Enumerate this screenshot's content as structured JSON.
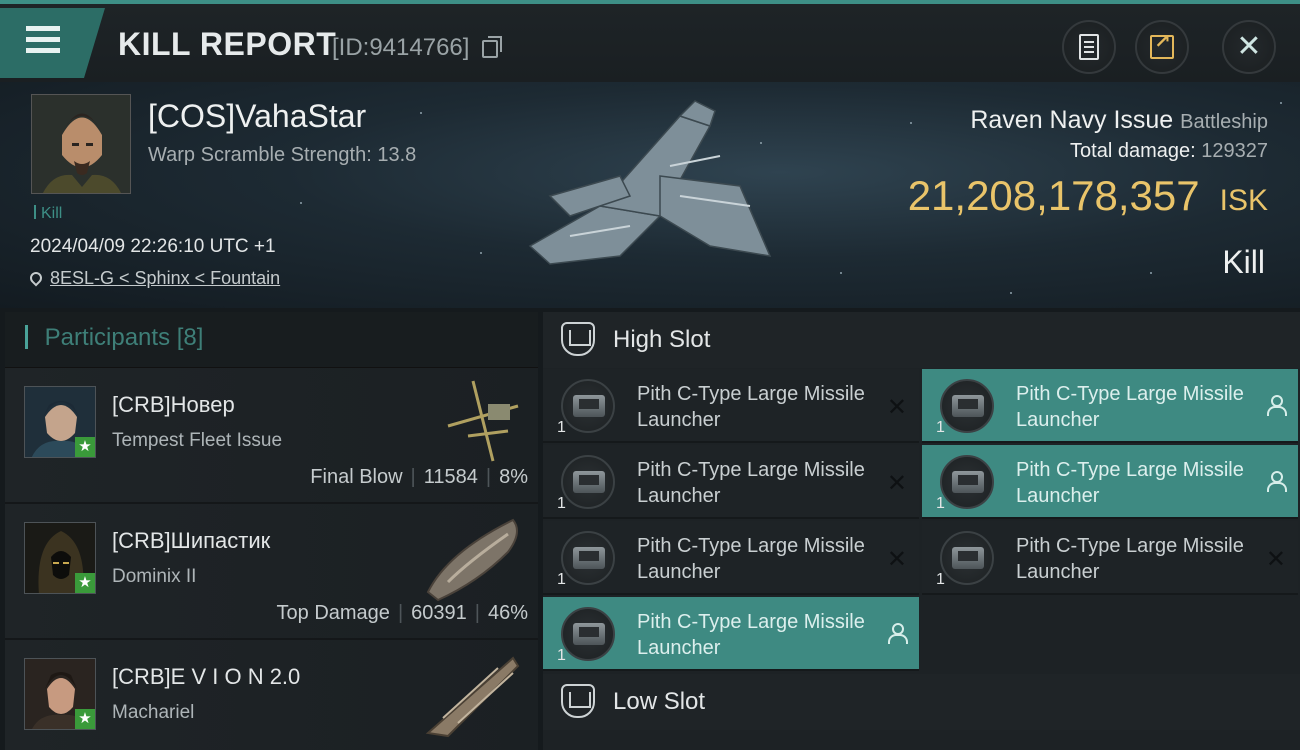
{
  "header": {
    "title": "KILL REPORT",
    "kill_id": "[ID:9414766]"
  },
  "victim": {
    "pilot": "[COS]VahaStar",
    "warp_scramble": "Warp Scramble Strength: 13.8",
    "tag": "Kill",
    "datetime": "2024/04/09 22:26:10 UTC +1",
    "location": "8ESL-G < Sphinx < Fountain",
    "ship": "Raven Navy Issue",
    "ship_class": "Battleship",
    "total_damage_label": "Total damage:",
    "total_damage": "129327",
    "isk_value": "21,208,178,357",
    "isk_unit": "ISK",
    "result": "Kill"
  },
  "participants": {
    "label": "Participants",
    "count": "[8]",
    "rows": [
      {
        "name": "[CRB]Новер",
        "ship": "Tempest Fleet Issue",
        "role": "Final Blow",
        "damage": "11584",
        "percent": "8%"
      },
      {
        "name": "[CRB]Шипастик",
        "ship": "Dominix II",
        "role": "Top Damage",
        "damage": "60391",
        "percent": "46%"
      },
      {
        "name": "[CRB]E V I O N 2.0",
        "ship": "Machariel",
        "role": "",
        "damage": "",
        "percent": ""
      }
    ]
  },
  "fitting": {
    "high_slot_label": "High Slot",
    "low_slot_label": "Low Slot",
    "high_slot_modules": [
      {
        "name": "Pith C-Type Large Missile Launcher",
        "qty": "1",
        "status": "destroyed"
      },
      {
        "name": "Pith C-Type Large Missile Launcher",
        "qty": "1",
        "status": "dropped"
      },
      {
        "name": "Pith C-Type Large Missile Launcher",
        "qty": "1",
        "status": "destroyed"
      },
      {
        "name": "Pith C-Type Large Missile Launcher",
        "qty": "1",
        "status": "dropped"
      },
      {
        "name": "Pith C-Type Large Missile Launcher",
        "qty": "1",
        "status": "destroyed"
      },
      {
        "name": "Pith C-Type Large Missile Launcher",
        "qty": "1",
        "status": "destroyed"
      },
      {
        "name": "Pith C-Type Large Missile Launcher",
        "qty": "1",
        "status": "dropped"
      }
    ]
  },
  "colors": {
    "accent": "#3e8a82",
    "isk": "#e9c46a",
    "star_badge": "#3a9a3a"
  }
}
